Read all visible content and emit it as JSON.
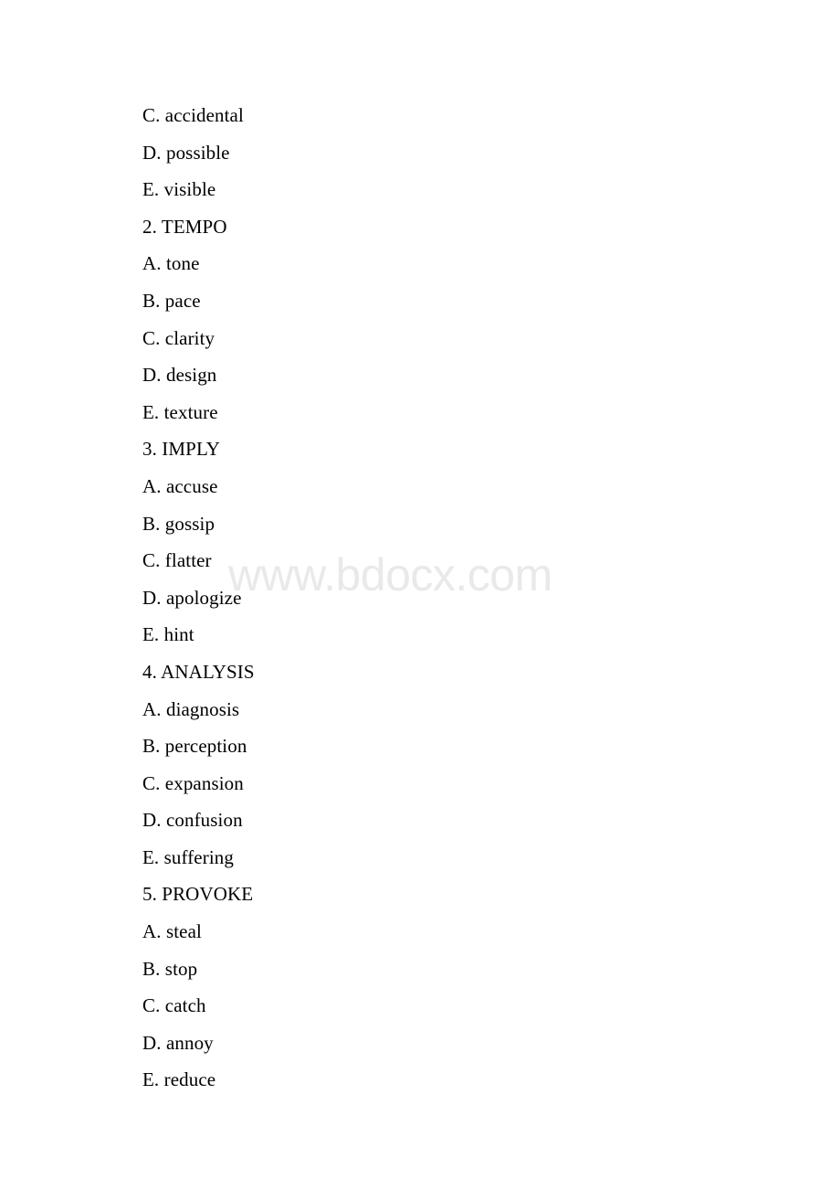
{
  "document": {
    "watermark": "www.bdocx.com",
    "background_color": "#ffffff",
    "text_color": "#000000",
    "watermark_color": "#e9e9e9",
    "lines": [
      {
        "text": "C. accidental",
        "kind": "option"
      },
      {
        "text": "D. possible",
        "kind": "option"
      },
      {
        "text": "E. visible",
        "kind": "option"
      },
      {
        "text": "2. TEMPO",
        "kind": "headword"
      },
      {
        "text": "A. tone",
        "kind": "option"
      },
      {
        "text": "B. pace",
        "kind": "option"
      },
      {
        "text": "C. clarity",
        "kind": "option"
      },
      {
        "text": "D. design",
        "kind": "option"
      },
      {
        "text": "E. texture",
        "kind": "option"
      },
      {
        "text": "3. IMPLY",
        "kind": "headword"
      },
      {
        "text": "A. accuse",
        "kind": "option"
      },
      {
        "text": "B. gossip",
        "kind": "option"
      },
      {
        "text": "C. flatter",
        "kind": "option"
      },
      {
        "text": "D. apologize",
        "kind": "option"
      },
      {
        "text": "E. hint",
        "kind": "option"
      },
      {
        "text": "4. ANALYSIS",
        "kind": "headword"
      },
      {
        "text": "A. diagnosis",
        "kind": "option"
      },
      {
        "text": "B. perception",
        "kind": "option"
      },
      {
        "text": "C. expansion",
        "kind": "option"
      },
      {
        "text": "D. confusion",
        "kind": "option"
      },
      {
        "text": "E. suffering",
        "kind": "option"
      },
      {
        "text": "5. PROVOKE",
        "kind": "headword"
      },
      {
        "text": "A. steal",
        "kind": "option"
      },
      {
        "text": "B. stop",
        "kind": "option"
      },
      {
        "text": "C. catch",
        "kind": "option"
      },
      {
        "text": "D. annoy",
        "kind": "option"
      },
      {
        "text": "E. reduce",
        "kind": "option"
      }
    ]
  }
}
